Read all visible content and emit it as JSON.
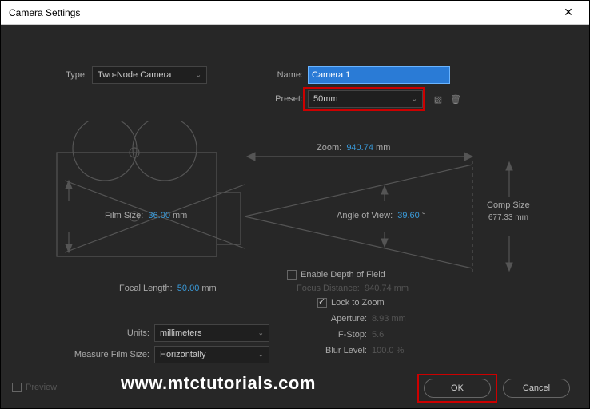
{
  "titlebar": {
    "title": "Camera Settings"
  },
  "type": {
    "label": "Type:",
    "value": "Two-Node Camera"
  },
  "name": {
    "label": "Name:",
    "value": "Camera 1"
  },
  "preset": {
    "label": "Preset:",
    "value": "50mm"
  },
  "zoom": {
    "label": "Zoom:",
    "value": "940.74",
    "unit": "mm"
  },
  "film_size": {
    "label": "Film Size:",
    "value": "36.00",
    "unit": "mm"
  },
  "angle_of_view": {
    "label": "Angle of View:",
    "value": "39.60",
    "unit": "°"
  },
  "comp_size": {
    "label": "Comp Size",
    "value": "677.33 mm"
  },
  "focal_length": {
    "label": "Focal Length:",
    "value": "50.00",
    "unit": "mm"
  },
  "enable_dof": {
    "label": "Enable Depth of Field",
    "checked": false
  },
  "focus_distance": {
    "label": "Focus Distance:",
    "value": "940.74",
    "unit": "mm"
  },
  "lock_to_zoom": {
    "label": "Lock to Zoom",
    "checked": true
  },
  "aperture": {
    "label": "Aperture:",
    "value": "8.93",
    "unit": "mm"
  },
  "fstop": {
    "label": "F-Stop:",
    "value": "5.6"
  },
  "blur_level": {
    "label": "Blur Level:",
    "value": "100.0",
    "unit": "%"
  },
  "units": {
    "label": "Units:",
    "value": "millimeters"
  },
  "measure_film_size": {
    "label": "Measure Film Size:",
    "value": "Horizontally"
  },
  "preview": {
    "label": "Preview",
    "checked": false
  },
  "buttons": {
    "ok": "OK",
    "cancel": "Cancel"
  },
  "watermark": "www.mtctutorials.com"
}
